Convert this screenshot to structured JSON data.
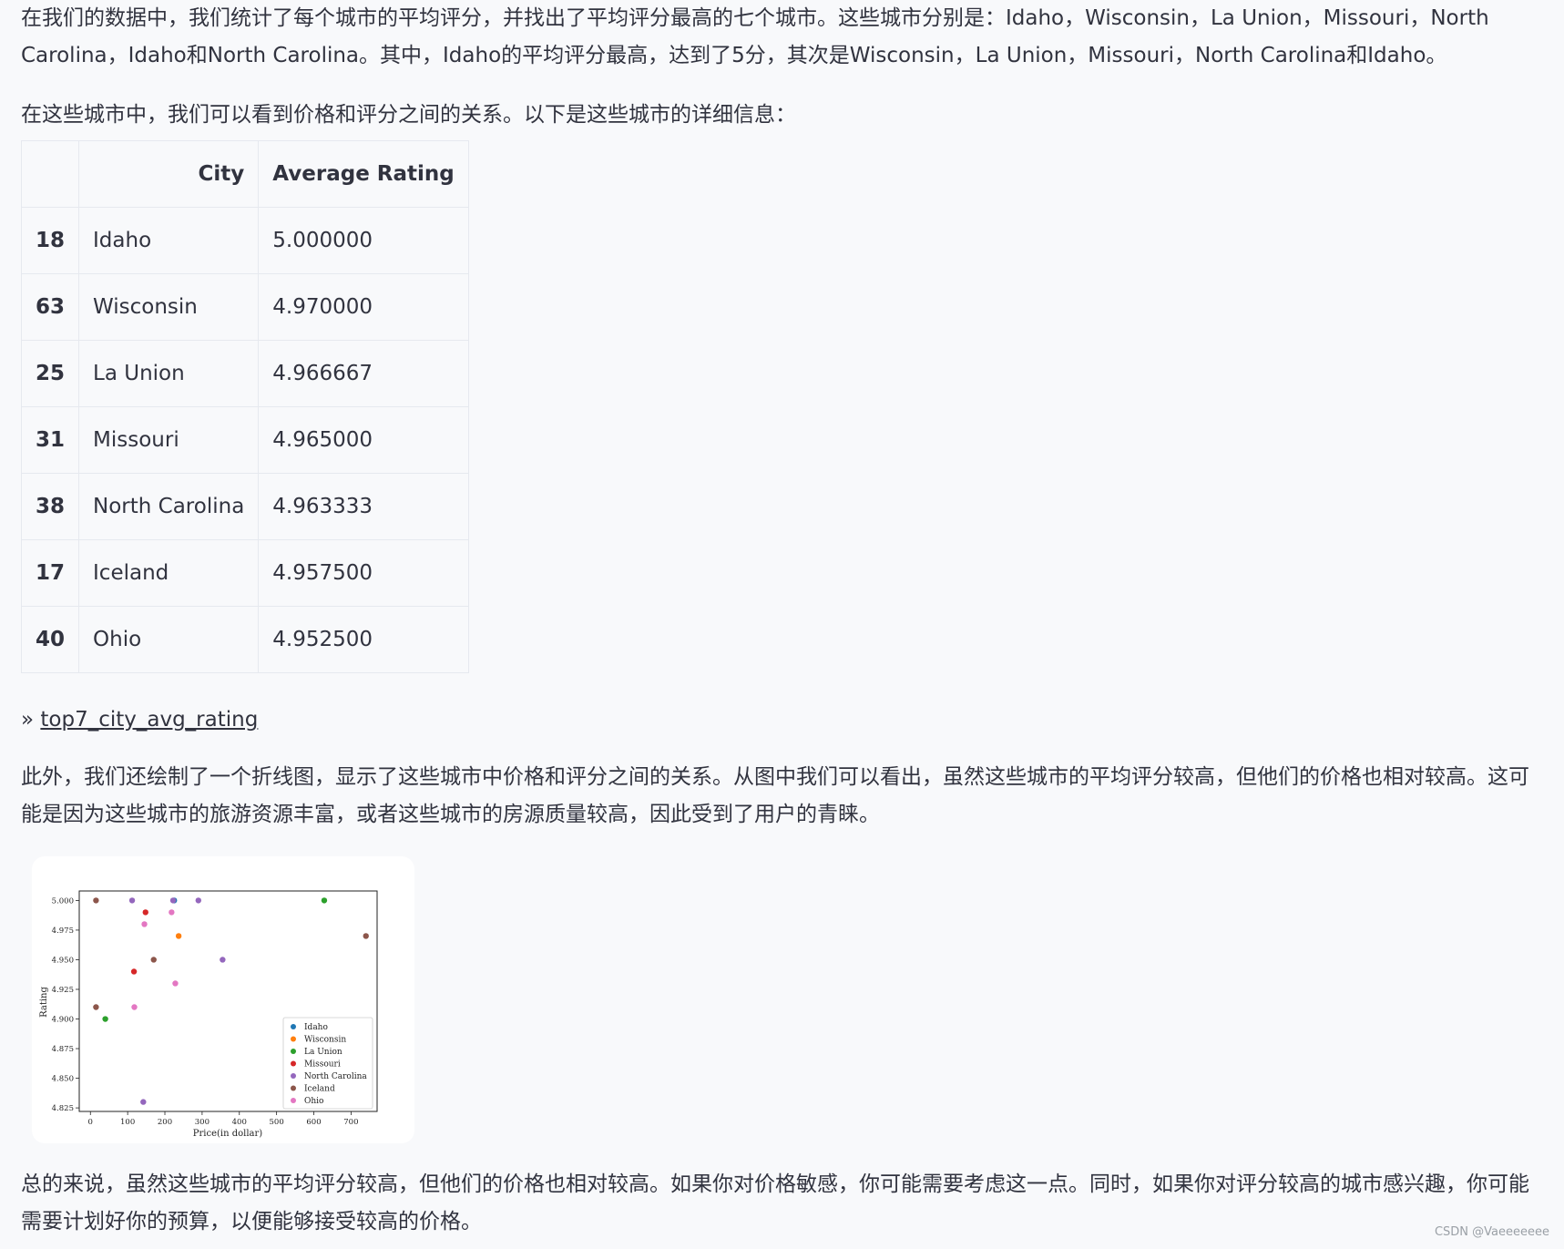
{
  "paragraphs": {
    "p1": "在我们的数据中，我们统计了每个城市的平均评分，并找出了平均评分最高的七个城市。这些城市分别是：Idaho，Wisconsin，La Union，Missouri，North Carolina，Idaho和North Carolina。其中，Idaho的平均评分最高，达到了5分，其次是Wisconsin，La Union，Missouri，North Carolina和Idaho。",
    "p2": "在这些城市中，我们可以看到价格和评分之间的关系。以下是这些城市的详细信息：",
    "p3": "此外，我们还绘制了一个折线图，显示了这些城市中价格和评分之间的关系。从图中我们可以看出，虽然这些城市的平均评分较高，但他们的价格也相对较高。这可能是因为这些城市的旅游资源丰富，或者这些城市的房源质量较高，因此受到了用户的青睐。",
    "p4": "总的来说，虽然这些城市的平均评分较高，但他们的价格也相对较高。如果你对价格敏感，你可能需要考虑这一点。同时，如果你对评分较高的城市感兴趣，你可能需要计划好你的预算，以便能够接受较高的价格。"
  },
  "table": {
    "headers": [
      "",
      "City",
      "Average Rating"
    ],
    "rows": [
      {
        "index": "18",
        "city": "Idaho",
        "rating": "5.000000"
      },
      {
        "index": "63",
        "city": "Wisconsin",
        "rating": "4.970000"
      },
      {
        "index": "25",
        "city": "La Union",
        "rating": "4.966667"
      },
      {
        "index": "31",
        "city": "Missouri",
        "rating": "4.965000"
      },
      {
        "index": "38",
        "city": "North Carolina",
        "rating": "4.963333"
      },
      {
        "index": "17",
        "city": "Iceland",
        "rating": "4.957500"
      },
      {
        "index": "40",
        "city": "Ohio",
        "rating": "4.952500"
      }
    ]
  },
  "expander": {
    "arrow": "»",
    "label": "top7_city_avg_rating"
  },
  "watermark": "CSDN @Vaeeeeeee",
  "chart_data": {
    "type": "scatter",
    "xlabel": "Price(in dollar)",
    "ylabel": "Rating",
    "xlim": [
      -30,
      770
    ],
    "ylim": [
      4.822,
      5.008
    ],
    "xticks": [
      0,
      100,
      200,
      300,
      400,
      500,
      600,
      700
    ],
    "yticks": [
      4.825,
      4.85,
      4.875,
      4.9,
      4.925,
      4.95,
      4.975,
      5.0
    ],
    "ytick_labels": [
      "4.825",
      "4.850",
      "4.875",
      "4.900",
      "4.925",
      "4.950",
      "4.975",
      "5.000"
    ],
    "grid": false,
    "legend_position": "lower right",
    "series": [
      {
        "name": "Idaho",
        "color": "#1f77b4",
        "points": [
          [
            225,
            5.0
          ]
        ]
      },
      {
        "name": "Wisconsin",
        "color": "#ff7f0e",
        "points": [
          [
            237,
            4.97
          ]
        ]
      },
      {
        "name": "La Union",
        "color": "#2ca02c",
        "points": [
          [
            628,
            5.0
          ],
          [
            40,
            4.9
          ]
        ]
      },
      {
        "name": "Missouri",
        "color": "#d62728",
        "points": [
          [
            148,
            4.99
          ],
          [
            117,
            4.94
          ]
        ]
      },
      {
        "name": "North Carolina",
        "color": "#9467bd",
        "points": [
          [
            112,
            5.0
          ],
          [
            222,
            5.0
          ],
          [
            290,
            5.0
          ],
          [
            355,
            4.95
          ],
          [
            142,
            4.83
          ]
        ]
      },
      {
        "name": "Iceland",
        "color": "#8c564b",
        "points": [
          [
            15,
            5.0
          ],
          [
            740,
            4.97
          ],
          [
            170,
            4.95
          ],
          [
            15,
            4.91
          ]
        ]
      },
      {
        "name": "Ohio",
        "color": "#e377c2",
        "points": [
          [
            218,
            4.99
          ],
          [
            145,
            4.98
          ],
          [
            228,
            4.93
          ],
          [
            118,
            4.91
          ]
        ]
      }
    ]
  }
}
